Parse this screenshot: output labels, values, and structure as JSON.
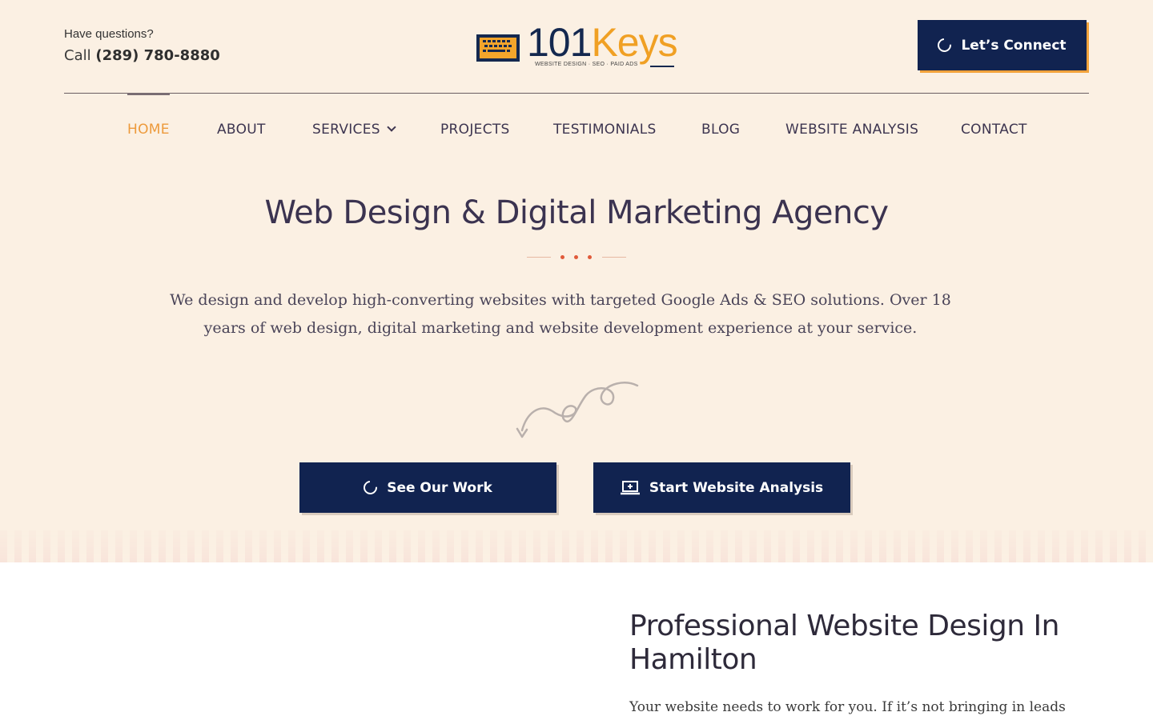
{
  "header": {
    "contact_question": "Have questions?",
    "call_prefix": "Call",
    "phone": "(289) 780-8880",
    "logo": {
      "number": "101",
      "word": "Keys",
      "tagline": "WEBSITE DESIGN · SEO · PAID ADS"
    },
    "cta_label": "Let’s Connect"
  },
  "nav": {
    "items": [
      {
        "label": "HOME",
        "active": true
      },
      {
        "label": "ABOUT"
      },
      {
        "label": "SERVICES",
        "has_dropdown": true
      },
      {
        "label": "PROJECTS"
      },
      {
        "label": "TESTIMONIALS"
      },
      {
        "label": "BLOG"
      },
      {
        "label": "WEBSITE ANALYSIS"
      },
      {
        "label": "CONTACT"
      }
    ]
  },
  "hero": {
    "title": "Web Design & Digital Marketing Agency",
    "description": "We design and develop high-converting websites with targeted Google Ads & SEO solutions. Over 18 years of web design, digital marketing and website development experience at your service.",
    "buttons": {
      "work_label": "See Our Work",
      "analysis_label": "Start Website Analysis"
    }
  },
  "section": {
    "title": "Professional Website Design In Hamilton",
    "text": "Your website needs to work for you. If it’s not bringing in leads or"
  },
  "colors": {
    "background_hero": "#fbf0e3",
    "navy": "#112350",
    "accent_orange": "#ed9a3b",
    "dot_red": "#e05a3a"
  },
  "icons": {
    "connect": "ring-icon",
    "work": "ring-icon",
    "analysis": "laptop-plus-icon",
    "services_dropdown": "chevron-down-icon"
  }
}
